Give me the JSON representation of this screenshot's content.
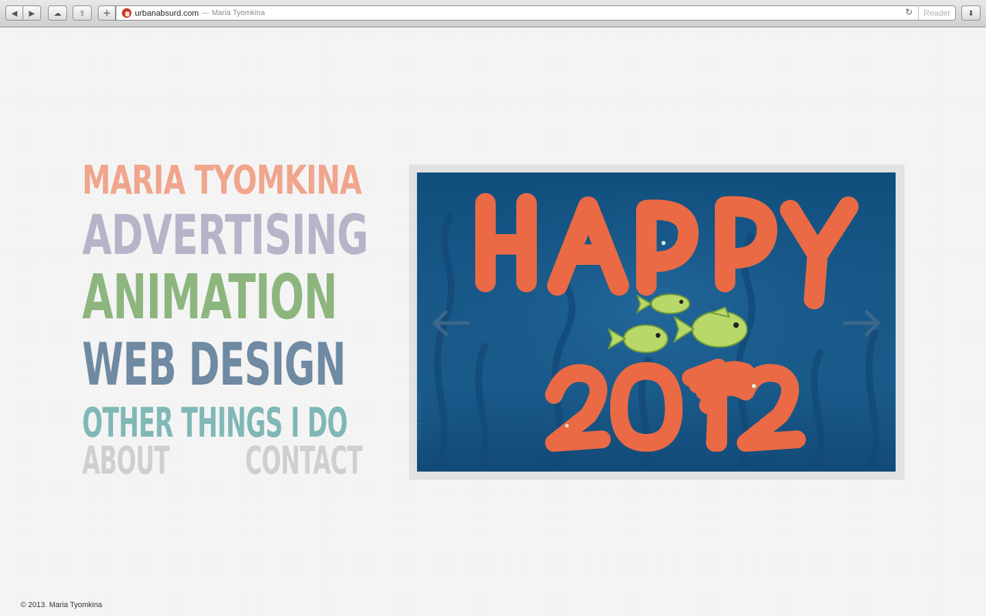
{
  "browser": {
    "domain": "urbanabsurd.com",
    "separator": "—",
    "page_title": "Maria Tyomkina",
    "reader_label": "Reader",
    "back_glyph": "◀",
    "forward_glyph": "▶",
    "cloud_glyph": "☁",
    "share_glyph": "⇪",
    "add_glyph": "+",
    "reload_glyph": "↻",
    "download_glyph": "⬇"
  },
  "nav": {
    "name": "MARIA TYOMKINA",
    "advertising": "ADVERTISING",
    "animation": "ANIMATION",
    "web_design": "WEB DESIGN",
    "other": "OTHER THINGS I DO",
    "about": "ABOUT",
    "contact": "CONTACT"
  },
  "colors": {
    "name": "#f0a58c",
    "advertising": "#b7b3c9",
    "animation": "#8db57e",
    "web_design": "#6f8aa2",
    "other": "#7fb8b6",
    "secondary": "#cfcfcf",
    "slide_letters": "#e96a45",
    "slide_bg": "#195b8c",
    "fish": "#b9d86a"
  },
  "slider": {
    "headline": "HAPPY",
    "year": "2012",
    "signature": "maria tyomkina",
    "prev_icon": "arrow-left-icon",
    "next_icon": "arrow-right-icon"
  },
  "footer": {
    "copyright": "© 2013. Maria Tyomkina"
  }
}
